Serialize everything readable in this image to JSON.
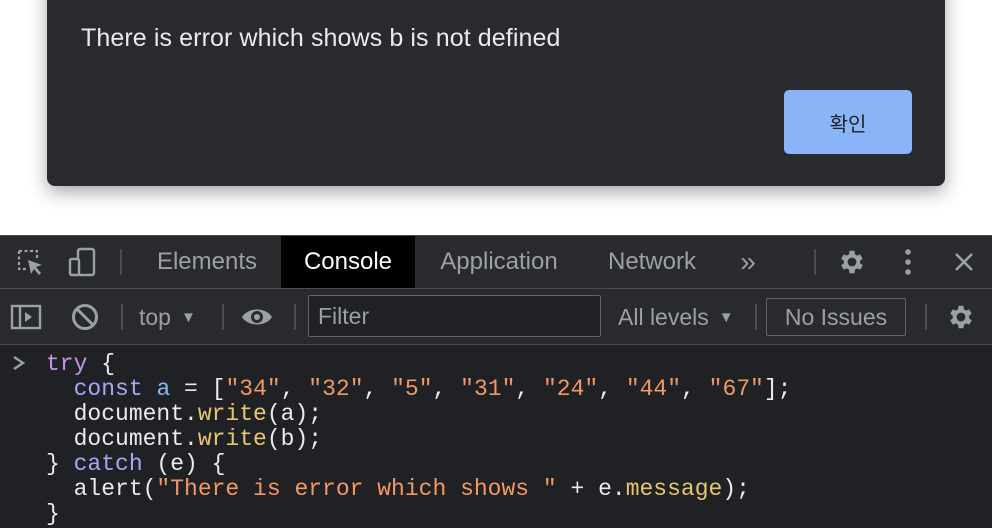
{
  "dialog": {
    "message": "There is error which shows b is not defined",
    "ok_label": "확인"
  },
  "devtools": {
    "tabs": [
      {
        "label": "Elements",
        "active": false
      },
      {
        "label": "Console",
        "active": true
      },
      {
        "label": "Application",
        "active": false
      },
      {
        "label": "Network",
        "active": false
      }
    ],
    "more_tabs_glyph": "»",
    "toolbar_icons": [
      "inspect-element-icon",
      "device-toolbar-icon",
      "settings-gear-icon",
      "more-options-icon",
      "close-icon"
    ],
    "console_toolbar": {
      "context": "top",
      "filter_placeholder": "Filter",
      "levels": "All levels",
      "issues": "No Issues",
      "icons": [
        "sidebar-toggle-icon",
        "clear-console-icon",
        "live-expression-eye-icon",
        "console-settings-gear-icon"
      ]
    },
    "console_code": {
      "prompt": ">",
      "l1_kw": "try",
      "l1_rest": " {",
      "l2_indent": "  ",
      "l2_kw": "const",
      "l2_var": "a",
      "l2_eq": " = [",
      "l2_s1": "\"34\"",
      "l2_s2": "\"32\"",
      "l2_s3": "\"5\"",
      "l2_s4": "\"31\"",
      "l2_s5": "\"24\"",
      "l2_s6": "\"44\"",
      "l2_s7": "\"67\"",
      "l2_end": "];",
      "comma": ", ",
      "l3_obj": "  document.",
      "l3_fn": "write",
      "l3_args": "(a);",
      "l4_obj": "  document.",
      "l4_fn": "write",
      "l4_args": "(b);",
      "l5_open": "} ",
      "l5_kw": "catch",
      "l5_rest": " (e) {",
      "l6_fn": "  alert(",
      "l6_str": "\"There is error which shows \"",
      "l6_mid": " + e.",
      "l6_prop": "message",
      "l6_end": ");",
      "l7": "}"
    },
    "colors": {
      "keyword": "#c792ea",
      "string": "#f29766",
      "function": "#e6c66e",
      "variable": "#86b8f0",
      "dialog_button": "#8ab4f8"
    }
  }
}
